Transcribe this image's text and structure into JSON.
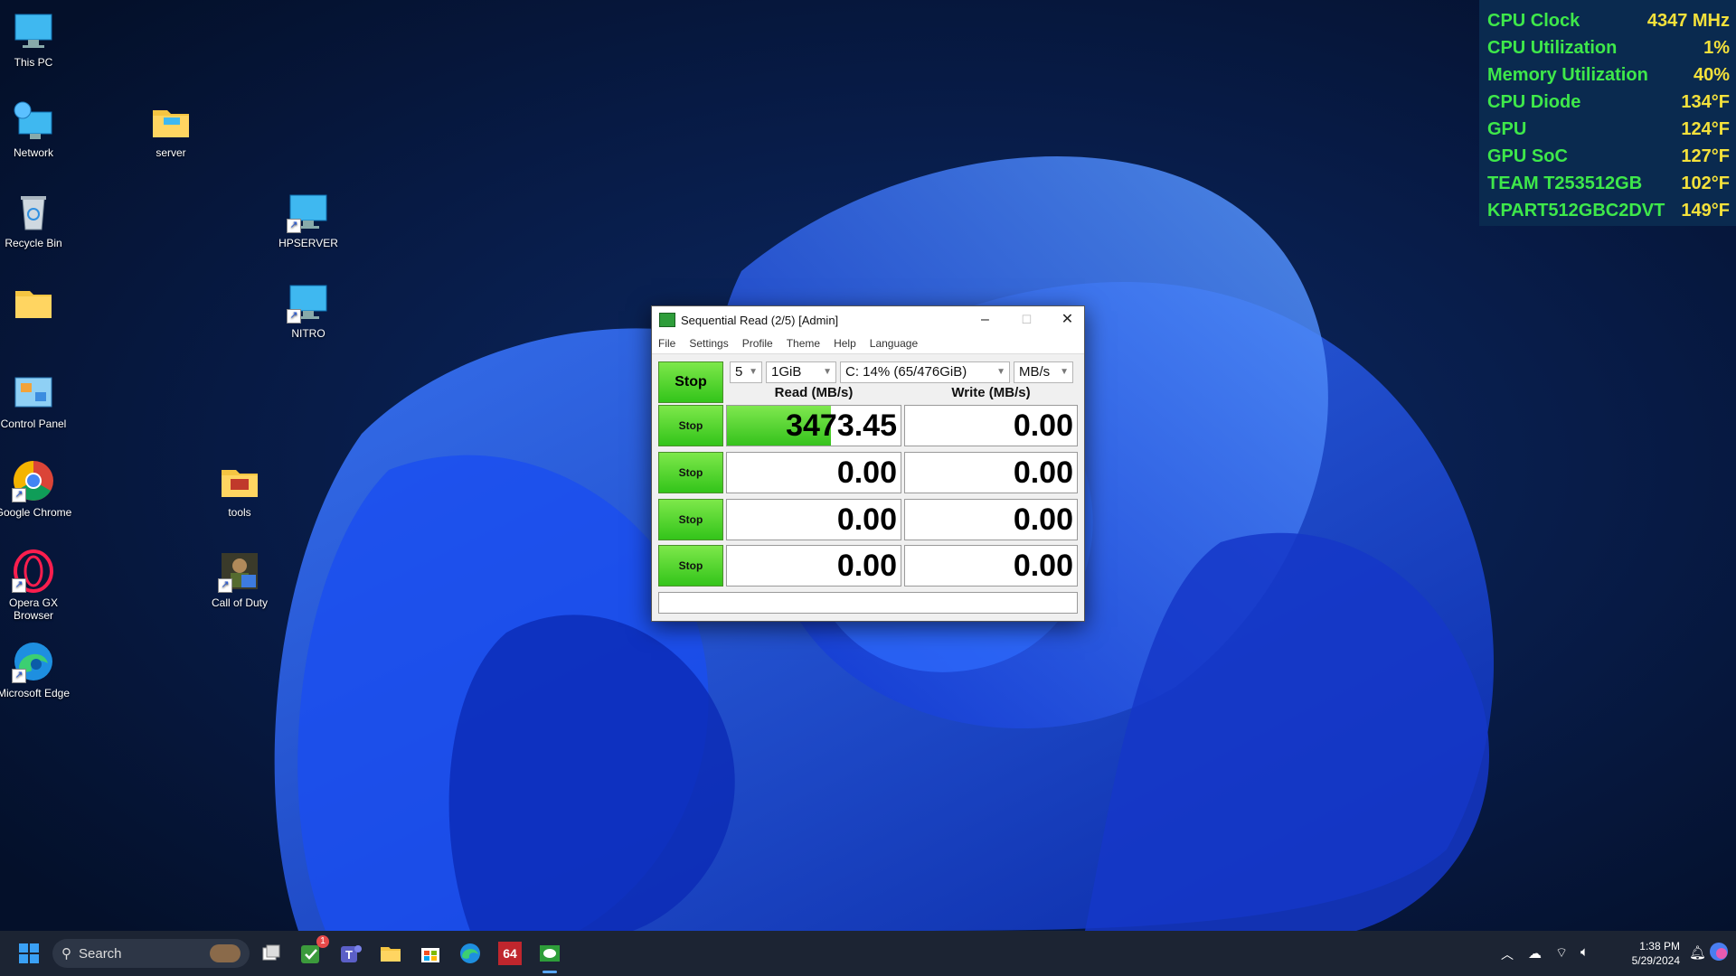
{
  "desktop": {
    "icons": [
      {
        "label": "This PC",
        "name": "this-pc"
      },
      {
        "label": "Network",
        "name": "network"
      },
      {
        "label": "server",
        "name": "server"
      },
      {
        "label": "Recycle Bin",
        "name": "recycle-bin"
      },
      {
        "label": "HPSERVER",
        "name": "hpserver"
      },
      {
        "label": "",
        "name": "folder"
      },
      {
        "label": "NITRO",
        "name": "nitro"
      },
      {
        "label": "Control Panel",
        "name": "control-panel"
      },
      {
        "label": "Google Chrome",
        "name": "google-chrome"
      },
      {
        "label": "tools",
        "name": "tools"
      },
      {
        "label": "Opera GX Browser",
        "name": "opera-gx"
      },
      {
        "label": "Call of Duty",
        "name": "call-of-duty"
      },
      {
        "label": "Microsoft Edge",
        "name": "microsoft-edge"
      }
    ]
  },
  "monitor": {
    "rows": [
      {
        "label": "CPU Clock",
        "value": "4347 MHz"
      },
      {
        "label": "CPU Utilization",
        "value": "1%"
      },
      {
        "label": "Memory Utilization",
        "value": "40%"
      },
      {
        "label": "CPU Diode",
        "value": "134°F"
      },
      {
        "label": "GPU",
        "value": "124°F"
      },
      {
        "label": "GPU SoC",
        "value": "127°F"
      },
      {
        "label": "TEAM T253512GB",
        "value": "102°F"
      },
      {
        "label": "KPART512GBC2DVT",
        "value": "149°F"
      }
    ]
  },
  "cdm": {
    "title": "Sequential Read (2/5) [Admin]",
    "menu": [
      "File",
      "Settings",
      "Profile",
      "Theme",
      "Help",
      "Language"
    ],
    "stop_main": "Stop",
    "count": "5",
    "size": "1GiB",
    "drive": "C: 14% (65/476GiB)",
    "unit": "MB/s",
    "read_header": "Read (MB/s)",
    "write_header": "Write (MB/s)",
    "rows": [
      {
        "stop": "Stop",
        "read": "3473.45",
        "write": "0.00",
        "read_progress": 0.6
      },
      {
        "stop": "Stop",
        "read": "0.00",
        "write": "0.00",
        "read_progress": 0
      },
      {
        "stop": "Stop",
        "read": "0.00",
        "write": "0.00",
        "read_progress": 0
      },
      {
        "stop": "Stop",
        "read": "0.00",
        "write": "0.00",
        "read_progress": 0
      }
    ],
    "status": ""
  },
  "taskbar": {
    "search_placeholder": "Search",
    "badge_count": "1",
    "aida_label": "64",
    "time": "1:38 PM",
    "date": "5/29/2024"
  }
}
